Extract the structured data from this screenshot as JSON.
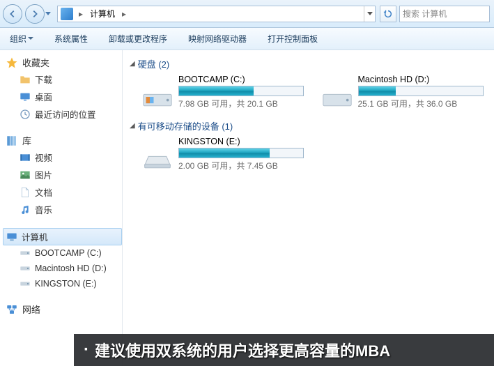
{
  "address": {
    "crumb": "计算机"
  },
  "search": {
    "placeholder": "搜索 计算机"
  },
  "toolbar": {
    "organize": "组织",
    "sysprops": "系统属性",
    "uninstall": "卸载或更改程序",
    "mapdrive": "映射网络驱动器",
    "controlpanel": "打开控制面板"
  },
  "sidebar": {
    "favorites": {
      "header": "收藏夹",
      "items": [
        "下载",
        "桌面",
        "最近访问的位置"
      ]
    },
    "libraries": {
      "header": "库",
      "items": [
        "视频",
        "图片",
        "文档",
        "音乐"
      ]
    },
    "computer": {
      "header": "计算机",
      "items": [
        "BOOTCAMP (C:)",
        "Macintosh HD (D:)",
        "KINGSTON (E:)"
      ]
    },
    "network": {
      "header": "网络"
    }
  },
  "sections": {
    "hdd": {
      "title": "硬盘 (2)"
    },
    "removable": {
      "title": "有可移动存储的设备 (1)"
    }
  },
  "drives": {
    "c": {
      "name": "BOOTCAMP (C:)",
      "status": "7.98 GB 可用，共 20.1 GB",
      "fill": 60
    },
    "d": {
      "name": "Macintosh HD (D:)",
      "status": "25.1 GB 可用，共 36.0 GB",
      "fill": 30
    },
    "e": {
      "name": "KINGSTON (E:)",
      "status": "2.00 GB 可用，共 7.45 GB",
      "fill": 73
    }
  },
  "caption": "建议使用双系统的用户选择更高容量的MBA"
}
